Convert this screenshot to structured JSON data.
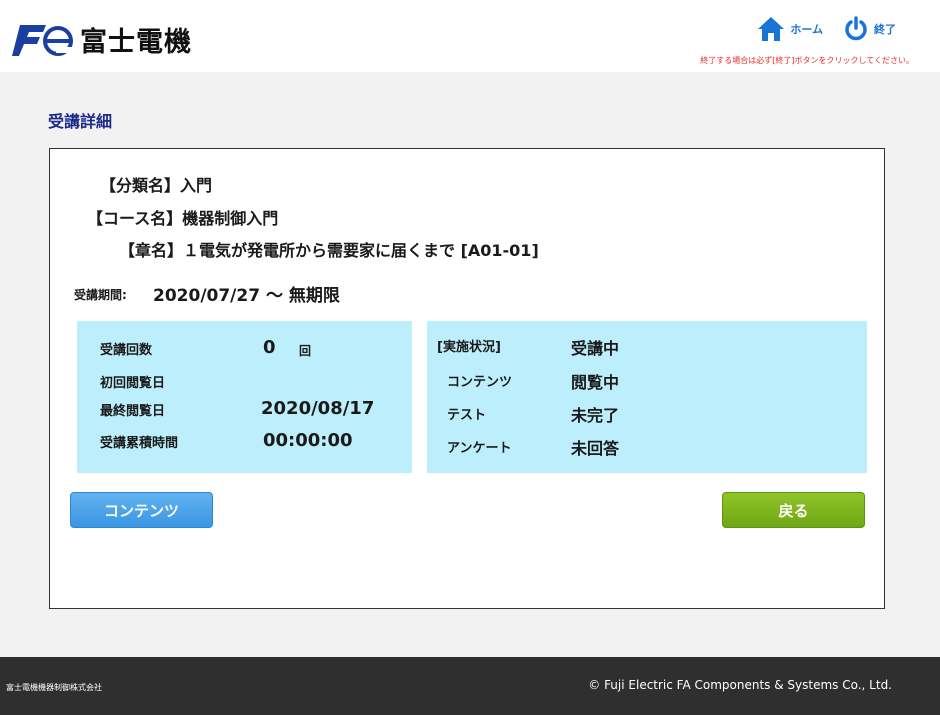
{
  "header": {
    "brand_text": "富士電機",
    "logo_letters": "Fe",
    "home_label": "ホーム",
    "exit_label": "終了",
    "notice": "終了する場合は必ず[終了]ボタンをクリックしてください。"
  },
  "page": {
    "title": "受講詳細"
  },
  "course": {
    "category_line": "【分類名】入門",
    "course_line": "【コース名】機器制御入門",
    "chapter_line": "【章名】１電気が発電所から需要家に届くまで [A01-01]",
    "period_label": "受講期間:",
    "period_value": "2020/07/27 ～ 無期限"
  },
  "stats": {
    "count_label": "受講回数",
    "count_value": "0",
    "count_unit": "回",
    "first_view_label": "初回閲覧日",
    "first_view_value": "",
    "last_view_label": "最終閲覧日",
    "last_view_value": "2020/08/17",
    "total_time_label": "受講累積時間",
    "total_time_value": "00:00:00"
  },
  "status": {
    "label": "[実施状況]",
    "value": "受講中",
    "contents_label": "コンテンツ",
    "contents_value": "閲覧中",
    "test_label": "テスト",
    "test_value": "未完了",
    "survey_label": "アンケート",
    "survey_value": "未回答"
  },
  "buttons": {
    "contents": "コンテンツ",
    "back": "戻る"
  },
  "footer": {
    "company": "富士電機機器制御株式会社",
    "copyright": "© Fuji Electric FA Components & Systems Co., Ltd."
  },
  "colors": {
    "accent_blue": "#1a73d6",
    "title_navy": "#1b2a8c",
    "box_cyan": "#bdeefb",
    "notice_red": "#e8302a",
    "back_green": "#6fa814"
  },
  "icons": {
    "home": "home-icon",
    "exit": "power-icon"
  }
}
